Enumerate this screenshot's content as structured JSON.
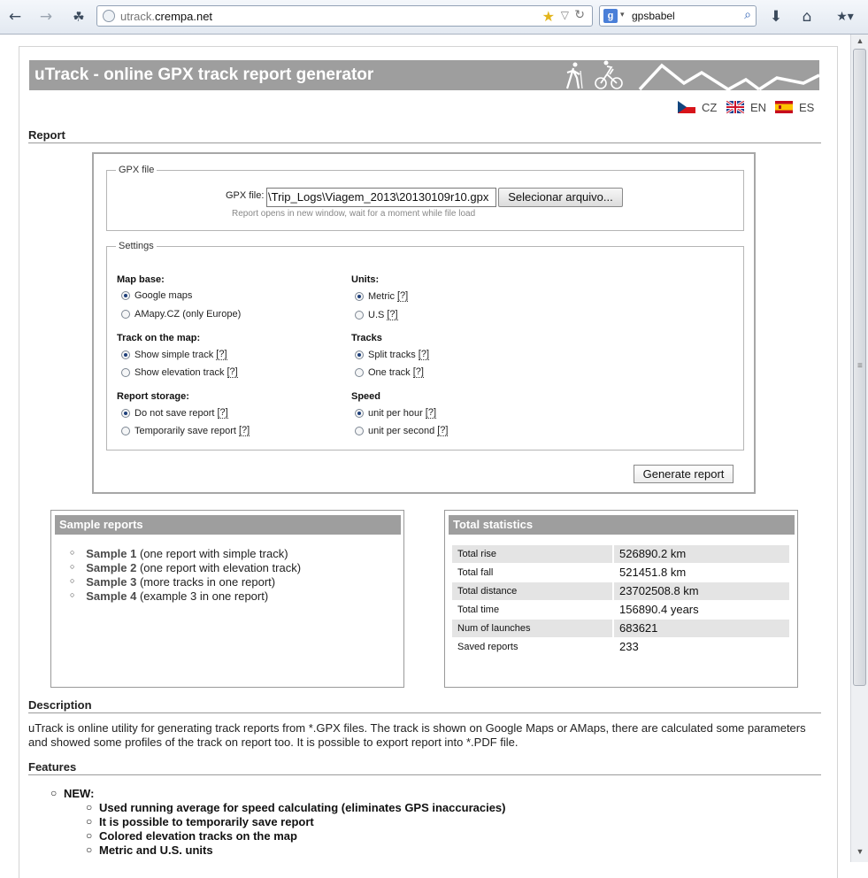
{
  "browser": {
    "url_host": "utrack.",
    "url_domain": "crempa.net",
    "search_value": "gpsbabel"
  },
  "banner": {
    "title": "uTrack - online GPX track report generator"
  },
  "languages": [
    {
      "code": "CZ"
    },
    {
      "code": "EN"
    },
    {
      "code": "ES"
    }
  ],
  "report": {
    "heading": "Report",
    "gpx_legend": "GPX file",
    "gpx_label": "GPX file:",
    "file_value": "\\Trip_Logs\\Viagem_2013\\20130109r10.gpx",
    "file_button": "Selecionar arquivo...",
    "hint": "Report opens in new window, wait for a moment while file load",
    "settings_legend": "Settings",
    "groups": {
      "map_base": {
        "title": "Map base:",
        "options": [
          {
            "label": "Google maps",
            "help": ""
          },
          {
            "label": "AMapy.CZ (only Europe)",
            "help": ""
          }
        ]
      },
      "units": {
        "title": "Units:",
        "options": [
          {
            "label": "Metric",
            "help": "[?]"
          },
          {
            "label": "U.S",
            "help": "[?]"
          }
        ]
      },
      "track_on_map": {
        "title": "Track on the map:",
        "options": [
          {
            "label": "Show simple track",
            "help": "[?]"
          },
          {
            "label": "Show elevation track",
            "help": "[?]"
          }
        ]
      },
      "tracks": {
        "title": "Tracks",
        "options": [
          {
            "label": "Split tracks",
            "help": "[?]"
          },
          {
            "label": "One track",
            "help": "[?]"
          }
        ]
      },
      "storage": {
        "title": "Report storage:",
        "options": [
          {
            "label": "Do not save report",
            "help": "[?]"
          },
          {
            "label": "Temporarily save report",
            "help": "[?]"
          }
        ]
      },
      "speed": {
        "title": "Speed",
        "options": [
          {
            "label": "unit per hour",
            "help": "[?]"
          },
          {
            "label": "unit per second",
            "help": "[?]"
          }
        ]
      }
    },
    "generate_button": "Generate report"
  },
  "samples": {
    "title": "Sample reports",
    "items": [
      {
        "link": "Sample 1",
        "text": " (one report with simple track)"
      },
      {
        "link": "Sample 2",
        "text": " (one report with elevation track)"
      },
      {
        "link": "Sample 3",
        "text": " (more tracks in one report)"
      },
      {
        "link": "Sample 4",
        "text": " (example 3 in one report)"
      }
    ]
  },
  "stats": {
    "title": "Total statistics",
    "rows": [
      {
        "label": "Total rise",
        "value": "526890.2 km"
      },
      {
        "label": "Total fall",
        "value": "521451.8 km"
      },
      {
        "label": "Total distance",
        "value": "23702508.8 km"
      },
      {
        "label": "Total time",
        "value": "156890.4 years"
      },
      {
        "label": "Num of launches",
        "value": "683621"
      },
      {
        "label": "Saved reports",
        "value": "233"
      }
    ]
  },
  "description": {
    "heading": "Description",
    "text": "uTrack is online utility for generating track reports from *.GPX files. The track is shown on Google Maps or AMaps, there are calculated some parameters and showed some profiles of the track on report too. It is possible to export report into *.PDF file."
  },
  "features": {
    "heading": "Features",
    "new_label": "NEW:",
    "items": [
      "Used running average for speed calculating (eliminates GPS inaccuracies)",
      "It is possible to temporarily save report",
      "Colored elevation tracks on the map",
      "Metric and U.S. units"
    ]
  }
}
